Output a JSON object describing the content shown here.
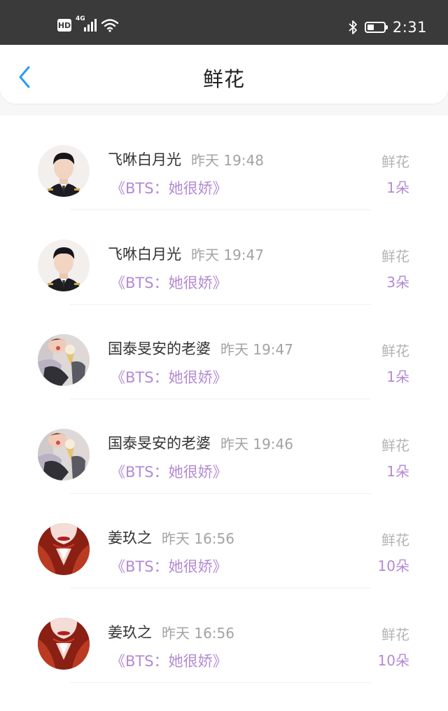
{
  "status_bar": {
    "hd": "HD",
    "network": "4G",
    "time": "2:31",
    "battery_level": 0.4,
    "icons": [
      "hd-icon",
      "signal-icon",
      "wifi-icon",
      "bluetooth-icon",
      "battery-icon"
    ]
  },
  "nav": {
    "title": "鲜花",
    "back_icon": "chevron-left-icon"
  },
  "colors": {
    "status_bar_bg": "#3a3a3a",
    "accent_blue": "#2a9cf0",
    "accent_purple": "#b48ad2",
    "text_primary": "#333333",
    "text_secondary": "#a3a3a3"
  },
  "records": [
    {
      "name": "飞咻白月光",
      "time": "昨天 19:48",
      "work": "《BTS：她很娇》",
      "gift": "鲜花",
      "count": "1朵",
      "avatar": "man-avatar"
    },
    {
      "name": "飞咻白月光",
      "time": "昨天 19:47",
      "work": "《BTS：她很娇》",
      "gift": "鲜花",
      "count": "3朵",
      "avatar": "man-avatar"
    },
    {
      "name": "国泰旻安的老婆",
      "time": "昨天 19:47",
      "work": "《BTS：她很娇》",
      "gift": "鲜花",
      "count": "1朵",
      "avatar": "icecream-avatar"
    },
    {
      "name": "国泰旻安的老婆",
      "time": "昨天 19:46",
      "work": "《BTS：她很娇》",
      "gift": "鲜花",
      "count": "1朵",
      "avatar": "icecream-avatar"
    },
    {
      "name": "姜玖之",
      "time": "昨天 16:56",
      "work": "《BTS：她很娇》",
      "gift": "鲜花",
      "count": "10朵",
      "avatar": "red-avatar"
    },
    {
      "name": "姜玖之",
      "time": "昨天 16:56",
      "work": "《BTS：她很娇》",
      "gift": "鲜花",
      "count": "10朵",
      "avatar": "red-avatar"
    }
  ]
}
